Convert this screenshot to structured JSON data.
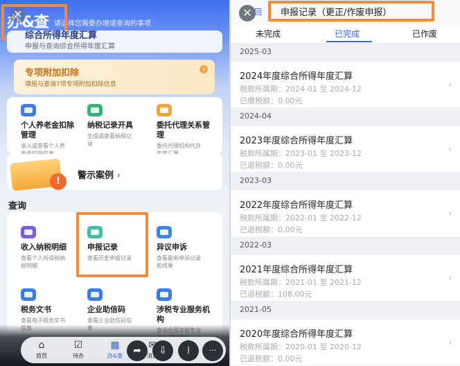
{
  "left": {
    "app_logo": "办&查",
    "hint": "请选择您需要办理或查询的事项",
    "top_card": {
      "title": "综合所得年度汇算",
      "subtitle": "申报与查询综合所得年度汇算"
    },
    "special_deduction": {
      "title": "专项附加扣除",
      "subtitle": "填报与查询7项专项附加扣除信息"
    },
    "services_row1": [
      {
        "name": "个人养老金扣除管理",
        "name_lines": [
          "个人养老金扣除",
          "管理"
        ],
        "desc_lines": [
          "录入或查看个人养",
          "老金扣除信息"
        ],
        "icon_color": "#3f7ce8"
      },
      {
        "name": "纳税记录开具",
        "name_lines": [
          "纳税记录开具"
        ],
        "desc_lines": [
          "生成或查看纳税记",
          "录"
        ],
        "icon_color": "#34b27c"
      },
      {
        "name": "委托代理关系管理",
        "name_lines": [
          "委托代理关系管",
          "理"
        ],
        "desc_lines": [
          "委托代理机构代办",
          "年度汇算"
        ],
        "icon_color": "#f2a33a"
      }
    ],
    "warning_case": "警示案例",
    "query_section": "查询",
    "services_row2": [
      {
        "name": "收入纳税明细",
        "desc_lines": [
          "查看个人所得税纳",
          "税明细"
        ],
        "icon_color": "#7a5ce6"
      },
      {
        "name": "申报记录",
        "desc_lines": [
          "查看历史申报记录"
        ],
        "icon_color": "#3fbfa4"
      },
      {
        "name": "异议申诉",
        "desc_lines": [
          "查看最新申诉记录",
          "和结果"
        ],
        "icon_color": "#3c86e8"
      }
    ],
    "services_row3": [
      {
        "name": "税务文书",
        "name_lines": [
          "税务文书"
        ],
        "desc_lines": [
          "查看电子税务文书",
          "信息"
        ],
        "icon_color": "#3c7ce8"
      },
      {
        "name": "企业助信码",
        "name_lines": [
          "企业助信码"
        ],
        "desc_lines": [
          "查看企业助信码信",
          "息"
        ],
        "icon_color": "#3c7ce8"
      },
      {
        "name": "涉税专业服务机构",
        "name_lines": [
          "涉税专业服务机",
          "构"
        ],
        "desc_lines": [
          "查询全国涉税专业",
          "服务机构信息"
        ],
        "icon_color": "#3c7ce8"
      }
    ],
    "nav": [
      {
        "label": "首页",
        "icon": "home-icon",
        "glyph": "⌂"
      },
      {
        "label": "待办",
        "icon": "todo-icon",
        "glyph": "☑"
      },
      {
        "label": "办&查",
        "icon": "handle-query-icon",
        "glyph": "▦"
      },
      {
        "label": "消息",
        "icon": "message-icon",
        "glyph": "✉"
      },
      {
        "label": "我的",
        "icon": "profile-icon",
        "glyph": "☺"
      }
    ],
    "close_glyph": "✕",
    "share_glyph": "➦",
    "save_glyph": "⇩",
    "apps_glyph": "⁞",
    "more_glyph": "···"
  },
  "right": {
    "back_label": "回",
    "title": "申报记录（更正/作废申报）",
    "tabs": [
      "未完成",
      "已完成",
      "已作废"
    ],
    "active_tab": "已完成",
    "close_glyph": "✕",
    "groups": [
      {
        "year": "2025-03",
        "title": "2024年度综合所得年度汇算",
        "period": "税款所属期：2024-01 至 2024-12",
        "amount": "已缴税额：0.00元"
      },
      {
        "year": "2024-04",
        "title": "2023年度综合所得年度汇算",
        "period": "税款所属期：2023-01 至 2023-12",
        "amount": "已退税额：0.00元"
      },
      {
        "year": "2023-03",
        "title": "2022年度综合所得年度汇算",
        "period": "税款所属期：2022-01 至 2022-12",
        "amount": "已退税额：0.00元"
      },
      {
        "year": "2022-03",
        "title": "2021年度综合所得年度汇算",
        "period": "税款所属期：2021-01 至 2021-12",
        "amount": "已退税额：108.00元"
      },
      {
        "year": "2021-05",
        "title": "2020年度综合所得年度汇算",
        "period": "税款所属期：2020-01 至 2020-12",
        "amount": "已退税额：0.00元"
      }
    ]
  },
  "colors": {
    "accent": "#2f63e8",
    "highlight_box": "#f28c38",
    "special_title": "#c5701a"
  }
}
